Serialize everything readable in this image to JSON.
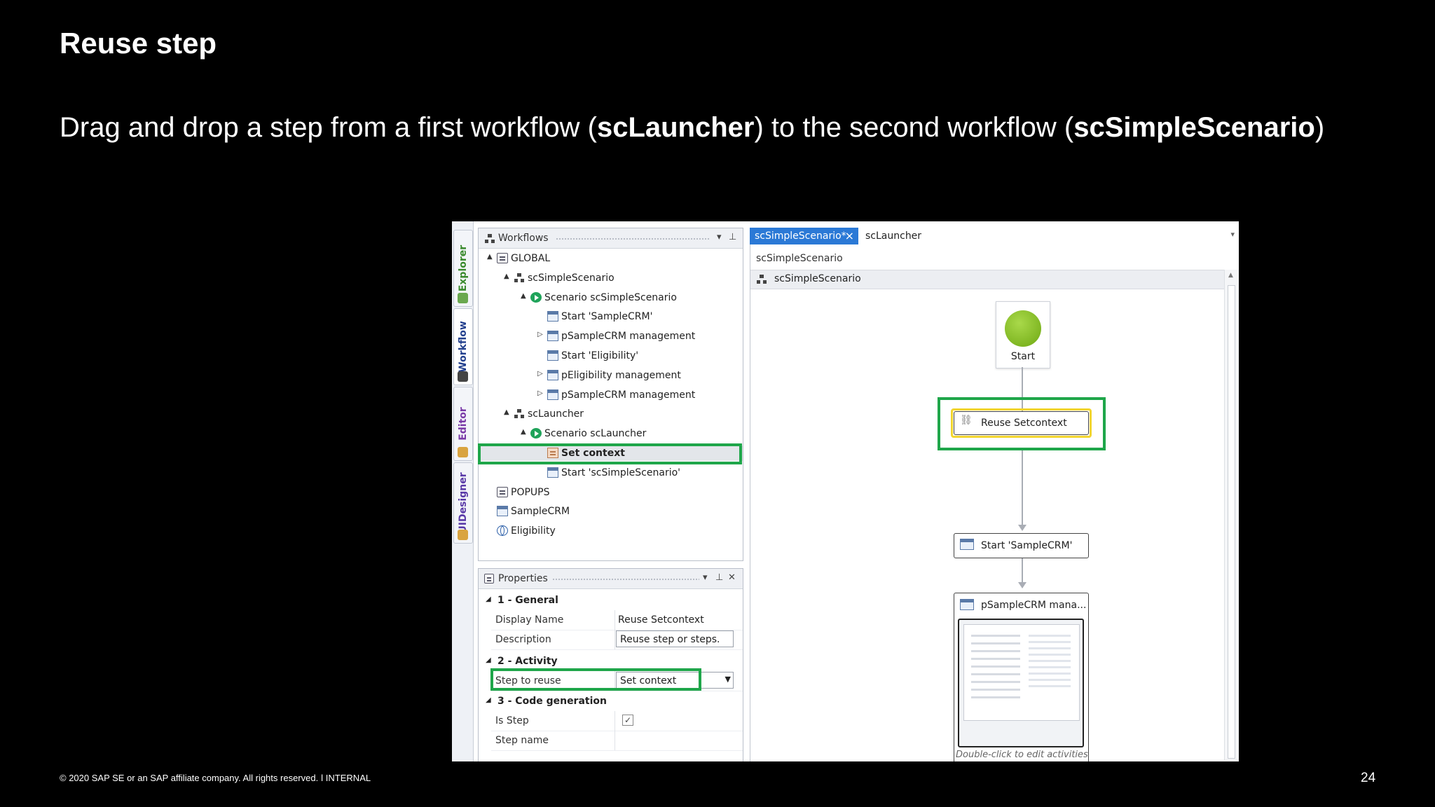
{
  "slide": {
    "title": "Reuse step",
    "subtitle_pre": "Drag and drop a step from a first workflow (",
    "subtitle_b1": "scLauncher",
    "subtitle_mid": ") to the second workflow (",
    "subtitle_b2": "scSimpleScenario",
    "subtitle_post": ")",
    "footer": "© 2020 SAP SE or an SAP affiliate company. All rights reserved.   ǀ   INTERNAL",
    "page_number": "24"
  },
  "side_tabs": [
    "Explorer",
    "Workflow",
    "Editor",
    "UIDesigner"
  ],
  "workflows_panel": {
    "title": "Workflows",
    "tree": [
      {
        "label": "GLOBAL",
        "icon": "doc-icon",
        "level": 0,
        "arrow": "▲"
      },
      {
        "label": "scSimpleScenario",
        "icon": "workflow-icon",
        "level": 1,
        "arrow": "▲"
      },
      {
        "label": "Scenario scSimpleScenario",
        "icon": "play-icon",
        "level": 2,
        "arrow": "▲"
      },
      {
        "label": "Start 'SampleCRM'",
        "icon": "screen-icon",
        "level": 3,
        "arrow": ""
      },
      {
        "label": "pSampleCRM management",
        "icon": "screen-icon",
        "level": 3,
        "arrow": "▷"
      },
      {
        "label": "Start 'Eligibility'",
        "icon": "screen-icon",
        "level": 3,
        "arrow": ""
      },
      {
        "label": "pEligibility management",
        "icon": "screen-icon",
        "level": 3,
        "arrow": "▷"
      },
      {
        "label": "pSampleCRM management",
        "icon": "screen-icon",
        "level": 3,
        "arrow": "▷"
      },
      {
        "label": "scLauncher",
        "icon": "workflow-icon",
        "level": 1,
        "arrow": "▲"
      },
      {
        "label": "Scenario scLauncher",
        "icon": "play-icon",
        "level": 2,
        "arrow": "▲"
      },
      {
        "label": "Set context",
        "icon": "set-context-icon",
        "level": 3,
        "arrow": "",
        "selected": true
      },
      {
        "label": "Start 'scSimpleScenario'",
        "icon": "screen-icon",
        "level": 3,
        "arrow": ""
      },
      {
        "label": "POPUPS",
        "icon": "doc-icon",
        "level": 0,
        "arrow": ""
      },
      {
        "label": "SampleCRM",
        "icon": "screen-icon",
        "level": 0,
        "arrow": ""
      },
      {
        "label": "Eligibility",
        "icon": "globe-icon",
        "level": 0,
        "arrow": ""
      }
    ]
  },
  "properties_panel": {
    "title": "Properties",
    "cat_general": "1 - General",
    "display_name_label": "Display Name",
    "display_name_value": "Reuse Setcontext",
    "description_label": "Description",
    "description_value": "Reuse step or steps.",
    "cat_activity": "2 - Activity",
    "step_to_reuse_label": "Step to reuse",
    "step_to_reuse_value": "Set context",
    "cat_codegen": "3 - Code generation",
    "is_step_label": "Is Step",
    "is_step_checked": "✓",
    "step_name_label": "Step name"
  },
  "designer": {
    "tab_active": "scSimpleScenario*",
    "tab_other": "scLauncher",
    "breadcrumb": "scSimpleScenario",
    "header": "scSimpleScenario",
    "start_label": "Start",
    "node_reuse": "Reuse Setcontext",
    "node_start_crm": "Start 'SampleCRM'",
    "node_psample": "pSampleCRM mana...",
    "hint": "Double-click to edit activities"
  },
  "colors": {
    "highlight": "#1fa64a",
    "accent": "#2b79d6",
    "start_node": "#7db514"
  }
}
